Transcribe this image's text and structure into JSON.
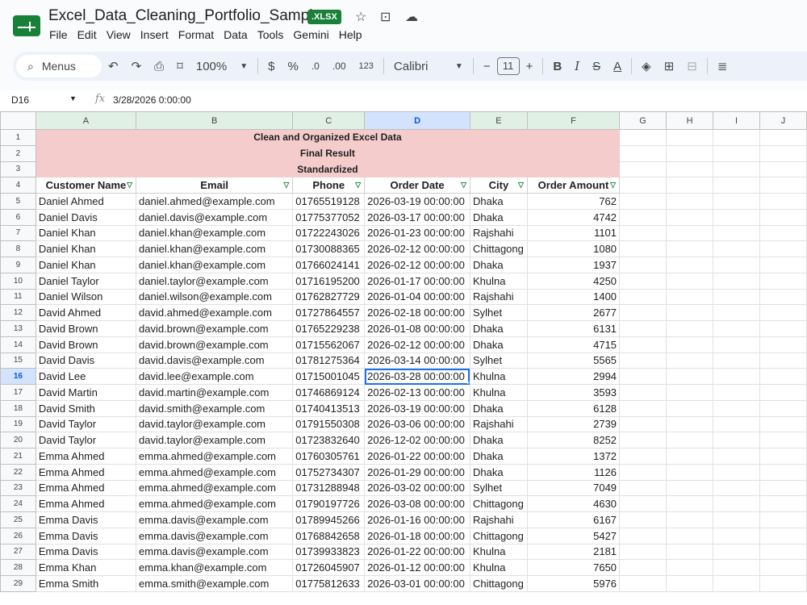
{
  "app": {
    "doc_title": "Excel_Data_Cleaning_Portfolio_Sample",
    "badge": ".XLSX",
    "menus": [
      "File",
      "Edit",
      "View",
      "Insert",
      "Format",
      "Data",
      "Tools",
      "Gemini",
      "Help"
    ]
  },
  "toolbar": {
    "search_label": "Menus",
    "zoom": "100%",
    "currency": "$",
    "percent": "%",
    "dec_decrease": ".0",
    "dec_increase": ".00",
    "number_format": "123",
    "font": "Calibri",
    "font_size": "11"
  },
  "formula_bar": {
    "cell_ref": "D16",
    "value": "3/28/2026 0:00:00"
  },
  "sheet": {
    "columns": [
      "A",
      "B",
      "C",
      "D",
      "E",
      "F",
      "G",
      "H",
      "I",
      "J"
    ],
    "banner": [
      "Clean and Organized Excel Data",
      "Final Result",
      "Standardized"
    ],
    "headers": [
      "Customer Name",
      "Email",
      "Phone",
      "Order Date",
      "City",
      "Order Amount"
    ],
    "rows": [
      [
        "5",
        "Daniel Ahmed",
        "daniel.ahmed@example.com",
        "01765519128",
        "2026-03-19 00:00:00",
        "Dhaka",
        "762"
      ],
      [
        "6",
        "Daniel Davis",
        "daniel.davis@example.com",
        "01775377052",
        "2026-03-17 00:00:00",
        "Dhaka",
        "4742"
      ],
      [
        "7",
        "Daniel Khan",
        "daniel.khan@example.com",
        "01722243026",
        "2026-01-23 00:00:00",
        "Rajshahi",
        "1101"
      ],
      [
        "8",
        "Daniel Khan",
        "daniel.khan@example.com",
        "01730088365",
        "2026-02-12 00:00:00",
        "Chittagong",
        "1080"
      ],
      [
        "9",
        "Daniel Khan",
        "daniel.khan@example.com",
        "01766024141",
        "2026-02-12 00:00:00",
        "Dhaka",
        "1937"
      ],
      [
        "10",
        "Daniel Taylor",
        "daniel.taylor@example.com",
        "01716195200",
        "2026-01-17 00:00:00",
        "Khulna",
        "4250"
      ],
      [
        "11",
        "Daniel Wilson",
        "daniel.wilson@example.com",
        "01762827729",
        "2026-01-04 00:00:00",
        "Rajshahi",
        "1400"
      ],
      [
        "12",
        "David Ahmed",
        "david.ahmed@example.com",
        "01727864557",
        "2026-02-18 00:00:00",
        "Sylhet",
        "2677"
      ],
      [
        "13",
        "David Brown",
        "david.brown@example.com",
        "01765229238",
        "2026-01-08 00:00:00",
        "Dhaka",
        "6131"
      ],
      [
        "14",
        "David Brown",
        "david.brown@example.com",
        "01715562067",
        "2026-02-12 00:00:00",
        "Dhaka",
        "4715"
      ],
      [
        "15",
        "David Davis",
        "david.davis@example.com",
        "01781275364",
        "2026-03-14 00:00:00",
        "Sylhet",
        "5565"
      ],
      [
        "16",
        "David Lee",
        "david.lee@example.com",
        "01715001045",
        "2026-03-28 00:00:00",
        "Khulna",
        "2994"
      ],
      [
        "17",
        "David Martin",
        "david.martin@example.com",
        "01746869124",
        "2026-02-13 00:00:00",
        "Khulna",
        "3593"
      ],
      [
        "18",
        "David Smith",
        "david.smith@example.com",
        "01740413513",
        "2026-03-19 00:00:00",
        "Dhaka",
        "6128"
      ],
      [
        "19",
        "David Taylor",
        "david.taylor@example.com",
        "01791550308",
        "2026-03-06 00:00:00",
        "Rajshahi",
        "2739"
      ],
      [
        "20",
        "David Taylor",
        "david.taylor@example.com",
        "01723832640",
        "2026-12-02 00:00:00",
        "Dhaka",
        "8252"
      ],
      [
        "21",
        "Emma Ahmed",
        "emma.ahmed@example.com",
        "01760305761",
        "2026-01-22 00:00:00",
        "Dhaka",
        "1372"
      ],
      [
        "22",
        "Emma Ahmed",
        "emma.ahmed@example.com",
        "01752734307",
        "2026-01-29 00:00:00",
        "Dhaka",
        "1126"
      ],
      [
        "23",
        "Emma Ahmed",
        "emma.ahmed@example.com",
        "01731288948",
        "2026-03-02 00:00:00",
        "Sylhet",
        "7049"
      ],
      [
        "24",
        "Emma Ahmed",
        "emma.ahmed@example.com",
        "01790197726",
        "2026-03-08 00:00:00",
        "Chittagong",
        "4630"
      ],
      [
        "25",
        "Emma Davis",
        "emma.davis@example.com",
        "01789945266",
        "2026-01-16 00:00:00",
        "Rajshahi",
        "6167"
      ],
      [
        "26",
        "Emma Davis",
        "emma.davis@example.com",
        "01768842658",
        "2026-01-18 00:00:00",
        "Chittagong",
        "5427"
      ],
      [
        "27",
        "Emma Davis",
        "emma.davis@example.com",
        "01739933823",
        "2026-01-22 00:00:00",
        "Khulna",
        "2181"
      ],
      [
        "28",
        "Emma Khan",
        "emma.khan@example.com",
        "01726045907",
        "2026-01-12 00:00:00",
        "Khulna",
        "7650"
      ],
      [
        "29",
        "Emma Smith",
        "emma.smith@example.com",
        "01775812633",
        "2026-03-01 00:00:00",
        "Chittagong",
        "5976"
      ]
    ],
    "selected_row": "16"
  }
}
